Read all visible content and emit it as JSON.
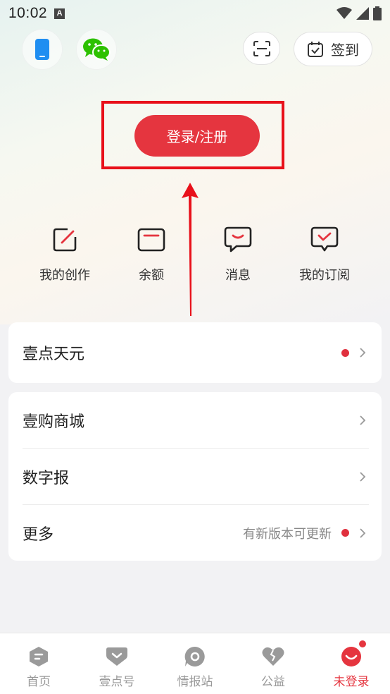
{
  "status_bar": {
    "time": "10:02",
    "notif_letter": "A"
  },
  "header": {
    "phone_icon": "phone-icon",
    "wechat_icon": "wechat-icon",
    "scan_icon": "scan-icon",
    "checkin_label": "签到"
  },
  "login": {
    "label": "登录/注册",
    "accent": "#e5353f"
  },
  "quick_actions": [
    {
      "label": "我的创作",
      "icon": "edit-icon"
    },
    {
      "label": "余额",
      "icon": "wallet-icon"
    },
    {
      "label": "消息",
      "icon": "message-icon"
    },
    {
      "label": "我的订阅",
      "icon": "subscribe-icon"
    }
  ],
  "card1": {
    "title": "壹点天元",
    "has_dot": true
  },
  "card2": {
    "rows": [
      {
        "title": "壹购商城"
      },
      {
        "title": "数字报"
      },
      {
        "title": "更多",
        "note": "有新版本可更新",
        "has_dot": true
      }
    ]
  },
  "tabs": [
    {
      "label": "首页",
      "icon": "home-icon"
    },
    {
      "label": "壹点号",
      "icon": "heart-badge-icon"
    },
    {
      "label": "情报站",
      "icon": "intel-icon"
    },
    {
      "label": "公益",
      "icon": "charity-icon"
    },
    {
      "label": "未登录",
      "icon": "profile-icon",
      "active": true
    }
  ]
}
